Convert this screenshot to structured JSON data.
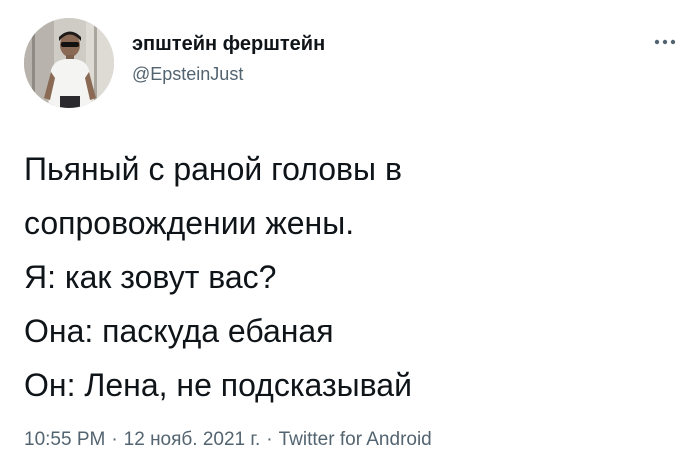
{
  "user": {
    "display_name": "эпштейн ферштейн",
    "handle": "@EpsteinJust",
    "avatar_icon": "profile-photo"
  },
  "tweet": {
    "lines": [
      "Пьяный с раной головы в",
      "сопровождении жены.",
      "Я: как зовут вас?",
      "Она: паскуда ебаная",
      "Он: Лена, не подсказывай"
    ]
  },
  "meta": {
    "time": "10:55 PM",
    "separator": "·",
    "date": "12 нояб. 2021 г.",
    "source": "Twitter for Android"
  },
  "icons": {
    "more": "more-dots-icon"
  },
  "colors": {
    "text": "#0f1419",
    "secondary": "#536471",
    "background": "#ffffff"
  }
}
